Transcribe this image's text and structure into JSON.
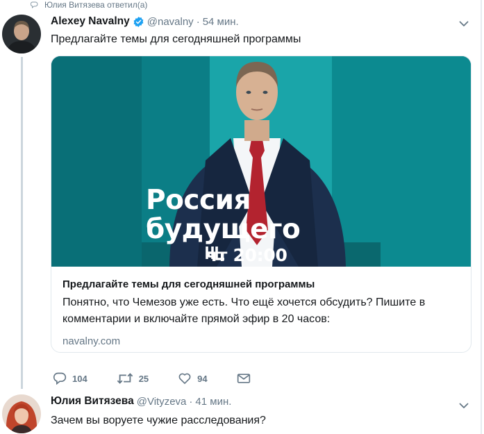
{
  "context": {
    "replied_label": "Юлия Витязева ответил(а)",
    "icon": "reply-icon"
  },
  "tweet": {
    "author_name": "Alexey Navalny",
    "verified_icon": "verified-badge-icon",
    "handle": "@navalny",
    "separator": "·",
    "time": "54 мин.",
    "text": "Предлагайте темы для сегодняшней программы",
    "card": {
      "image_line1": "Россия",
      "image_line2": "будущего",
      "image_logo": "NL-logo-icon",
      "image_schedule": "чт 20:00",
      "title": "Предлагайте темы для сегодняшней программы",
      "description": "Понятно, что Чемезов уже есть. Что ещё хочется обсудить? Пишите в комментарии и включайте прямой эфир в 20 часов:",
      "domain": "navalny.com"
    },
    "actions": {
      "reply_count": "104",
      "retweet_count": "25",
      "like_count": "94"
    },
    "colors": {
      "accent": "#1da1f2",
      "card_background": "#0b7e86",
      "tie": "#b3232f"
    }
  },
  "reply": {
    "author_name": "Юлия Витязева",
    "handle": "@Vityzeva",
    "separator": "·",
    "time": "41 мин.",
    "text": "Зачем вы воруете чужие расследования?"
  }
}
